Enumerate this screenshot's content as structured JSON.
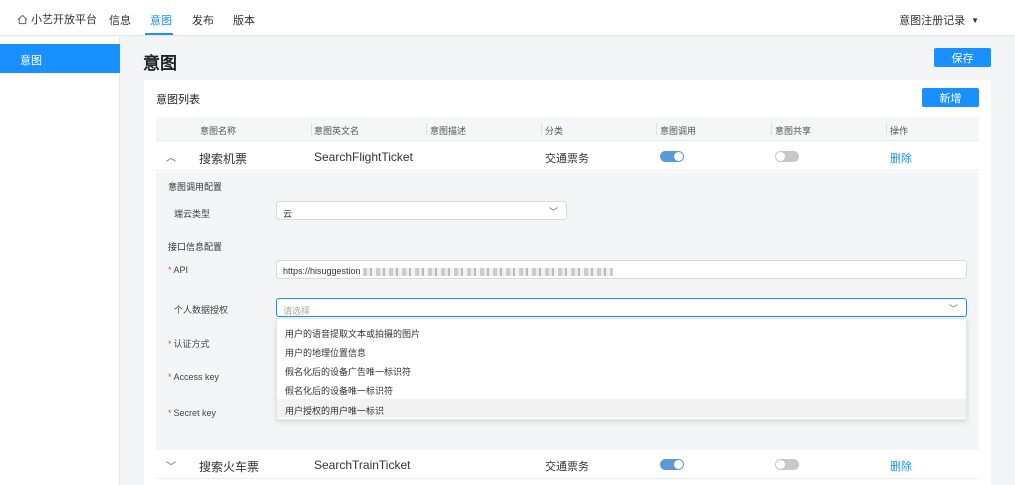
{
  "nav": {
    "brand": "小艺开放平台",
    "items": [
      {
        "label": "信息"
      },
      {
        "label": "意图"
      },
      {
        "label": "发布"
      },
      {
        "label": "版本"
      }
    ],
    "active_index": 1,
    "registry_label": "意图注册记录"
  },
  "sidebar": {
    "items": [
      {
        "label": "意图"
      }
    ]
  },
  "page": {
    "title": "意图",
    "save_label": "保存"
  },
  "list": {
    "title": "意图列表",
    "add_label": "新增",
    "columns": [
      "意图名称",
      "意图英文名",
      "意图描述",
      "分类",
      "意图调用",
      "意图共享",
      "操作"
    ],
    "rows": [
      {
        "name": "搜索机票",
        "en_name": "SearchFlightTicket",
        "description": "",
        "category": "交通票务",
        "invoke_on": true,
        "share_on": false,
        "action": "删除",
        "expanded": true
      },
      {
        "name": "搜索火车票",
        "en_name": "SearchTrainTicket",
        "description": "",
        "category": "交通票务",
        "invoke_on": true,
        "share_on": false,
        "action": "删除",
        "expanded": false
      }
    ]
  },
  "config": {
    "invoke_section": "意图调用配置",
    "edge_cloud_label": "端云类型",
    "edge_cloud_value": "云",
    "api_section": "接口信息配置",
    "api_label": "API",
    "api_value": "https://hisuggestion",
    "data_auth_label": "个人数据授权",
    "data_auth_placeholder": "请选择",
    "auth_method_label": "认证方式",
    "access_key_label": "Access key",
    "secret_key_label": "Secret key",
    "required_mark": "*"
  },
  "dropdown": {
    "options": [
      "用户的语音提取文本或拍摄的图片",
      "用户的地理位置信息",
      "假名化后的设备广告唯一标识符",
      "假名化后的设备唯一标识符",
      "用户授权的用户唯一标识"
    ],
    "hover_index": 4
  },
  "colors": {
    "primary": "#1890ff",
    "switch_on": "#5b9bd5",
    "switch_off": "#c8c8c8",
    "required": "#e74c3c"
  }
}
